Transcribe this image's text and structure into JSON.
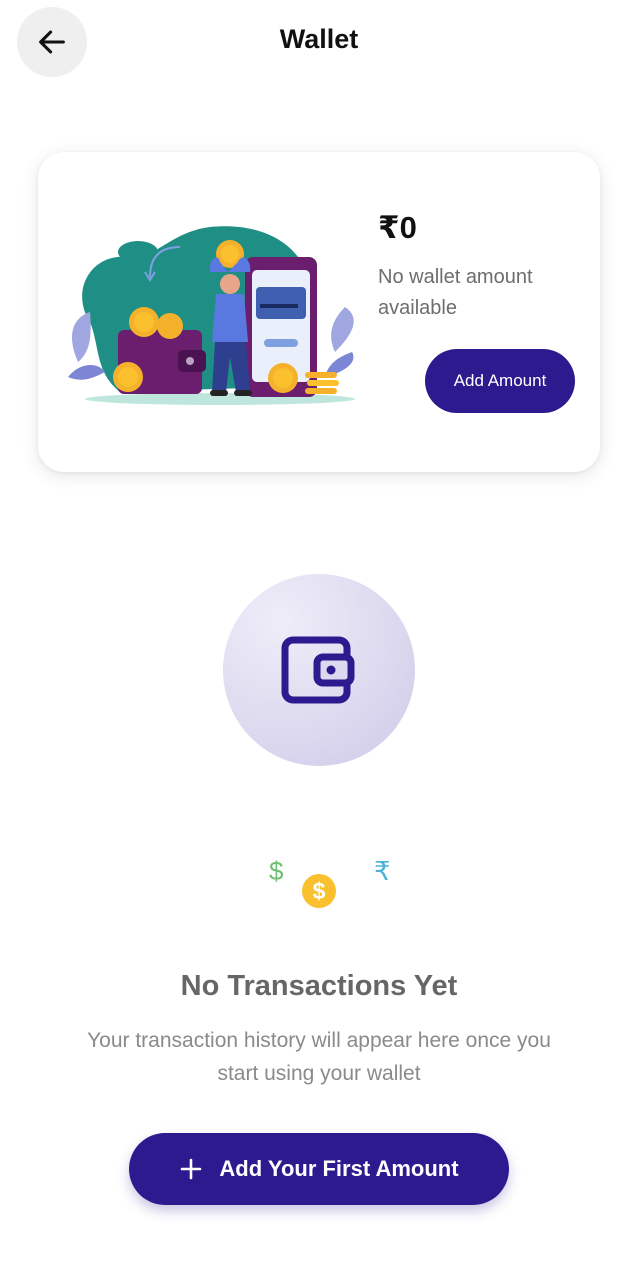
{
  "header": {
    "title": "Wallet",
    "back_icon": "arrow-left-icon"
  },
  "wallet_card": {
    "balance": "₹0",
    "no_amount_text": "No wallet amount available",
    "add_amount_label": "Add Amount",
    "illustration": "person-holding-coin-wallet-phone-illustration"
  },
  "empty_state": {
    "icon": "wallet-icon",
    "currency_icons": {
      "dollar": "$",
      "coin": "$",
      "rupee": "₹"
    },
    "title": "No Transactions Yet",
    "description": "Your transaction history will appear here once you start using your wallet",
    "cta_label": "Add Your First Amount",
    "cta_icon": "plus-icon"
  },
  "colors": {
    "primary": "#2d1a8e",
    "teal_blob": "#1f8f86",
    "coin": "#fbc02d",
    "dollar_green": "#6fbf73",
    "rupee_blue": "#4fb3d9",
    "wallet_purple": "#6b1d6e"
  }
}
